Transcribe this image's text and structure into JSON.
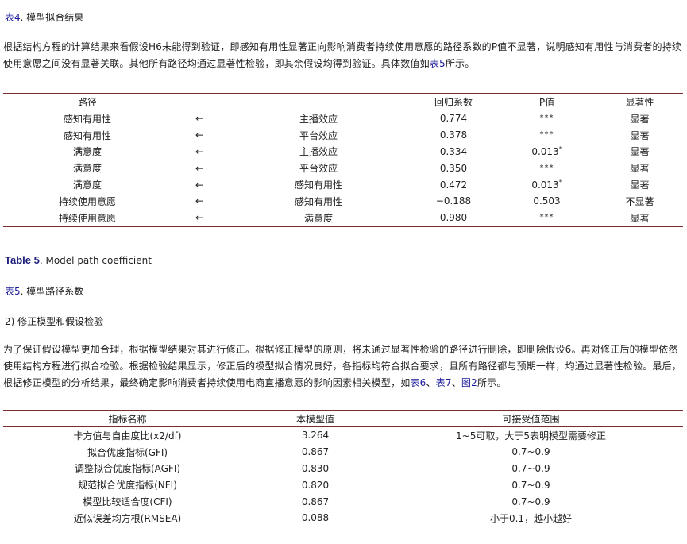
{
  "table4_caption": {
    "label": "表4",
    "text": ". 模型拟合结果"
  },
  "para1": {
    "text_a": "根据结构方程的计算结果来看假设H6未能得到验证，即感知有用性显著正向影响消费者持续使用意愿的路径系数的P值不显著，说明感知有用性与消费者的持续使用意愿之间没有显著关联。其他所有路径均通过显著性检验，即其余假设均得到验证。具体数值如",
    "link": "表5",
    "text_b": "所示。"
  },
  "path_table": {
    "headers": [
      "路径",
      "回归系数",
      "P值",
      "显著性"
    ],
    "rows": [
      {
        "from": "感知有用性",
        "arrow": "←",
        "to": "主播效应",
        "coef": "0.774",
        "p": "***",
        "sup": "",
        "sig": "显著"
      },
      {
        "from": "感知有用性",
        "arrow": "←",
        "to": "平台效应",
        "coef": "0.378",
        "p": "***",
        "sup": "",
        "sig": "显著"
      },
      {
        "from": "满意度",
        "arrow": "←",
        "to": "主播效应",
        "coef": "0.334",
        "p": "0.013",
        "sup": "*",
        "sig": "显著"
      },
      {
        "from": "满意度",
        "arrow": "←",
        "to": "平台效应",
        "coef": "0.350",
        "p": "***",
        "sup": "",
        "sig": "显著"
      },
      {
        "from": "满意度",
        "arrow": "←",
        "to": "感知有用性",
        "coef": "0.472",
        "p": "0.013",
        "sup": "*",
        "sig": "显著"
      },
      {
        "from": "持续使用意愿",
        "arrow": "←",
        "to": "感知有用性",
        "coef": "−0.188",
        "p": "0.503",
        "sup": "",
        "sig": "不显著"
      },
      {
        "from": "持续使用意愿",
        "arrow": "←",
        "to": "满意度",
        "coef": "0.980",
        "p": "***",
        "sup": "",
        "sig": "显著"
      }
    ]
  },
  "table5_en_caption": {
    "label": "Table 5",
    "text": ". Model path coefficient"
  },
  "table5_cn_caption": {
    "label": "表5",
    "text": ". 模型路径系数"
  },
  "section_heading": "2) 修正模型和假设检验",
  "para2": {
    "text_a": "为了保证假设模型更加合理，根据模型结果对其进行修正。根据修正模型的原则，将未通过显著性检验的路径进行删除，即删除假设6。再对修正后的模型依然使用结构方程进行拟合检验。根据检验结果显示，修正后的模型拟合情况良好，各指标均符合拟合要求，且所有路径都与预期一样，均通过显著性检验。最后，根据修正模型的分析结果，最终确定影响消费者持续使用电商直播意愿的影响因素相关模型，如",
    "link1": "表6",
    "sep1": "、",
    "link2": "表7",
    "sep2": "、",
    "link3": "图2",
    "text_b": "所示。"
  },
  "fit_table": {
    "headers": [
      "指标名称",
      "本模型值",
      "可接受值范围"
    ],
    "rows": [
      {
        "name": "卡方值与自由度比(x2/df)",
        "value": "3.264",
        "range": "1~5可取，大于5表明模型需要修正"
      },
      {
        "name": "拟合优度指标(GFI)",
        "value": "0.867",
        "range": "0.7~0.9"
      },
      {
        "name": "调整拟合优度指标(AGFI)",
        "value": "0.830",
        "range": "0.7~0.9"
      },
      {
        "name": "规范拟合优度指标(NFI)",
        "value": "0.820",
        "range": "0.7~0.9"
      },
      {
        "name": "模型比较适合度(CFI)",
        "value": "0.867",
        "range": "0.7~0.9"
      },
      {
        "name": "近似误差均方根(RMSEA)",
        "value": "0.088",
        "range": "小于0.1，越小越好"
      }
    ]
  }
}
